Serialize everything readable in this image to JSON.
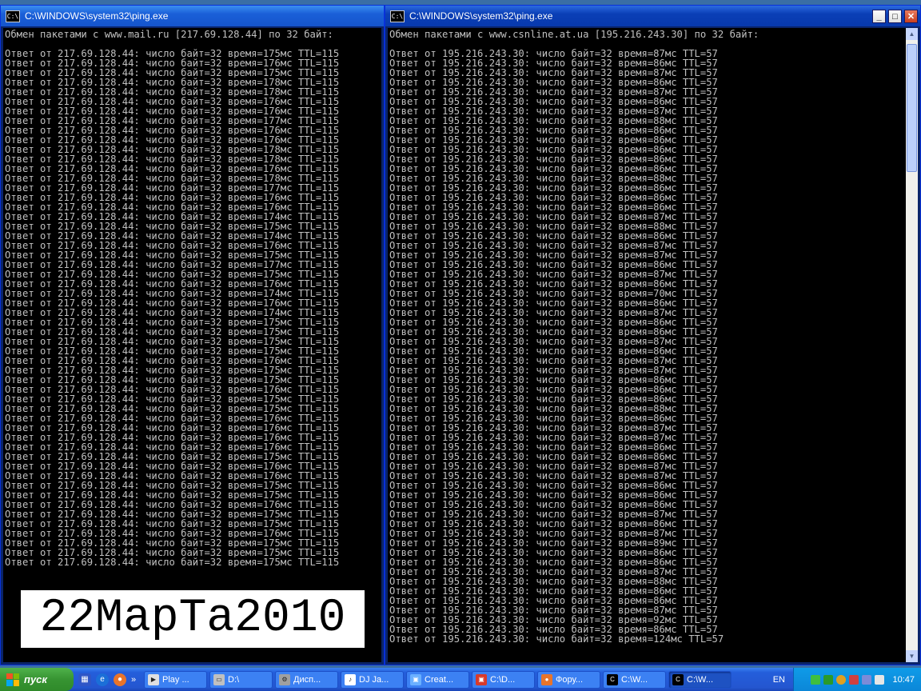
{
  "left_window": {
    "title": "C:\\WINDOWS\\system32\\ping.exe",
    "icon_text": "C:\\",
    "lines": [
      "Обмен пакетами с www.mail.ru [217.69.128.44] по 32 байт:",
      "",
      "Ответ от 217.69.128.44: число байт=32 время=175мс TTL=115",
      "Ответ от 217.69.128.44: число байт=32 время=176мс TTL=115",
      "Ответ от 217.69.128.44: число байт=32 время=175мс TTL=115",
      "Ответ от 217.69.128.44: число байт=32 время=178мс TTL=115",
      "Ответ от 217.69.128.44: число байт=32 время=178мс TTL=115",
      "Ответ от 217.69.128.44: число байт=32 время=176мс TTL=115",
      "Ответ от 217.69.128.44: число байт=32 время=176мс TTL=115",
      "Ответ от 217.69.128.44: число байт=32 время=177мс TTL=115",
      "Ответ от 217.69.128.44: число байт=32 время=176мс TTL=115",
      "Ответ от 217.69.128.44: число байт=32 время=176мс TTL=115",
      "Ответ от 217.69.128.44: число байт=32 время=178мс TTL=115",
      "Ответ от 217.69.128.44: число байт=32 время=178мс TTL=115",
      "Ответ от 217.69.128.44: число байт=32 время=176мс TTL=115",
      "Ответ от 217.69.128.44: число байт=32 время=178мс TTL=115",
      "Ответ от 217.69.128.44: число байт=32 время=177мс TTL=115",
      "Ответ от 217.69.128.44: число байт=32 время=176мс TTL=115",
      "Ответ от 217.69.128.44: число байт=32 время=176мс TTL=115",
      "Ответ от 217.69.128.44: число байт=32 время=174мс TTL=115",
      "Ответ от 217.69.128.44: число байт=32 время=175мс TTL=115",
      "Ответ от 217.69.128.44: число байт=32 время=174мс TTL=115",
      "Ответ от 217.69.128.44: число байт=32 время=176мс TTL=115",
      "Ответ от 217.69.128.44: число байт=32 время=175мс TTL=115",
      "Ответ от 217.69.128.44: число байт=32 время=177мс TTL=115",
      "Ответ от 217.69.128.44: число байт=32 время=175мс TTL=115",
      "Ответ от 217.69.128.44: число байт=32 время=176мс TTL=115",
      "Ответ от 217.69.128.44: число байт=32 время=174мс TTL=115",
      "Ответ от 217.69.128.44: число байт=32 время=176мс TTL=115",
      "Ответ от 217.69.128.44: число байт=32 время=174мс TTL=115",
      "Ответ от 217.69.128.44: число байт=32 время=175мс TTL=115",
      "Ответ от 217.69.128.44: число байт=32 время=175мс TTL=115",
      "Ответ от 217.69.128.44: число байт=32 время=175мс TTL=115",
      "Ответ от 217.69.128.44: число байт=32 время=175мс TTL=115",
      "Ответ от 217.69.128.44: число байт=32 время=176мс TTL=115",
      "Ответ от 217.69.128.44: число байт=32 время=175мс TTL=115",
      "Ответ от 217.69.128.44: число байт=32 время=175мс TTL=115",
      "Ответ от 217.69.128.44: число байт=32 время=176мс TTL=115",
      "Ответ от 217.69.128.44: число байт=32 время=175мс TTL=115",
      "Ответ от 217.69.128.44: число байт=32 время=175мс TTL=115",
      "Ответ от 217.69.128.44: число байт=32 время=176мс TTL=115",
      "Ответ от 217.69.128.44: число байт=32 время=176мс TTL=115",
      "Ответ от 217.69.128.44: число байт=32 время=176мс TTL=115",
      "Ответ от 217.69.128.44: число байт=32 время=176мс TTL=115",
      "Ответ от 217.69.128.44: число байт=32 время=175мс TTL=115",
      "Ответ от 217.69.128.44: число байт=32 время=176мс TTL=115",
      "Ответ от 217.69.128.44: число байт=32 время=176мс TTL=115",
      "Ответ от 217.69.128.44: число байт=32 время=175мс TTL=115",
      "Ответ от 217.69.128.44: число байт=32 время=175мс TTL=115",
      "Ответ от 217.69.128.44: число байт=32 время=176мс TTL=115",
      "Ответ от 217.69.128.44: число байт=32 время=175мс TTL=115",
      "Ответ от 217.69.128.44: число байт=32 время=175мс TTL=115",
      "Ответ от 217.69.128.44: число байт=32 время=176мс TTL=115",
      "Ответ от 217.69.128.44: число байт=32 время=175мс TTL=115",
      "Ответ от 217.69.128.44: число байт=32 время=175мс TTL=115",
      "Ответ от 217.69.128.44: число байт=32 время=175мс TTL=115"
    ]
  },
  "right_window": {
    "title": "C:\\WINDOWS\\system32\\ping.exe",
    "icon_text": "C:\\",
    "buttons": {
      "minimize": "_",
      "maximize": "□",
      "close": "✕"
    },
    "lines": [
      "Обмен пакетами с www.csnline.at.ua [195.216.243.30] по 32 байт:",
      "",
      "Ответ от 195.216.243.30: число байт=32 время=87мс TTL=57",
      "Ответ от 195.216.243.30: число байт=32 время=86мс TTL=57",
      "Ответ от 195.216.243.30: число байт=32 время=87мс TTL=57",
      "Ответ от 195.216.243.30: число байт=32 время=86мс TTL=57",
      "Ответ от 195.216.243.30: число байт=32 время=87мс TTL=57",
      "Ответ от 195.216.243.30: число байт=32 время=86мс TTL=57",
      "Ответ от 195.216.243.30: число байт=32 время=87мс TTL=57",
      "Ответ от 195.216.243.30: число байт=32 время=88мс TTL=57",
      "Ответ от 195.216.243.30: число байт=32 время=86мс TTL=57",
      "Ответ от 195.216.243.30: число байт=32 время=86мс TTL=57",
      "Ответ от 195.216.243.30: число байт=32 время=86мс TTL=57",
      "Ответ от 195.216.243.30: число байт=32 время=86мс TTL=57",
      "Ответ от 195.216.243.30: число байт=32 время=86мс TTL=57",
      "Ответ от 195.216.243.30: число байт=32 время=88мс TTL=57",
      "Ответ от 195.216.243.30: число байт=32 время=86мс TTL=57",
      "Ответ от 195.216.243.30: число байт=32 время=86мс TTL=57",
      "Ответ от 195.216.243.30: число байт=32 время=86мс TTL=57",
      "Ответ от 195.216.243.30: число байт=32 время=87мс TTL=57",
      "Ответ от 195.216.243.30: число байт=32 время=88мс TTL=57",
      "Ответ от 195.216.243.30: число байт=32 время=86мс TTL=57",
      "Ответ от 195.216.243.30: число байт=32 время=87мс TTL=57",
      "Ответ от 195.216.243.30: число байт=32 время=87мс TTL=57",
      "Ответ от 195.216.243.30: число байт=32 время=86мс TTL=57",
      "Ответ от 195.216.243.30: число байт=32 время=87мс TTL=57",
      "Ответ от 195.216.243.30: число байт=32 время=86мс TTL=57",
      "Ответ от 195.216.243.30: число байт=32 время=70мс TTL=57",
      "Ответ от 195.216.243.30: число байт=32 время=86мс TTL=57",
      "Ответ от 195.216.243.30: число байт=32 время=87мс TTL=57",
      "Ответ от 195.216.243.30: число байт=32 время=86мс TTL=57",
      "Ответ от 195.216.243.30: число байт=32 время=86мс TTL=57",
      "Ответ от 195.216.243.30: число байт=32 время=87мс TTL=57",
      "Ответ от 195.216.243.30: число байт=32 время=86мс TTL=57",
      "Ответ от 195.216.243.30: число байт=32 время=87мс TTL=57",
      "Ответ от 195.216.243.30: число байт=32 время=87мс TTL=57",
      "Ответ от 195.216.243.30: число байт=32 время=86мс TTL=57",
      "Ответ от 195.216.243.30: число байт=32 время=86мс TTL=57",
      "Ответ от 195.216.243.30: число байт=32 время=86мс TTL=57",
      "Ответ от 195.216.243.30: число байт=32 время=88мс TTL=57",
      "Ответ от 195.216.243.30: число байт=32 время=86мс TTL=57",
      "Ответ от 195.216.243.30: число байт=32 время=87мс TTL=57",
      "Ответ от 195.216.243.30: число байт=32 время=87мс TTL=57",
      "Ответ от 195.216.243.30: число байт=32 время=86мс TTL=57",
      "Ответ от 195.216.243.30: число байт=32 время=86мс TTL=57",
      "Ответ от 195.216.243.30: число байт=32 время=87мс TTL=57",
      "Ответ от 195.216.243.30: число байт=32 время=87мс TTL=57",
      "Ответ от 195.216.243.30: число байт=32 время=86мс TTL=57",
      "Ответ от 195.216.243.30: число байт=32 время=86мс TTL=57",
      "Ответ от 195.216.243.30: число байт=32 время=86мс TTL=57",
      "Ответ от 195.216.243.30: число байт=32 время=87мс TTL=57",
      "Ответ от 195.216.243.30: число байт=32 время=86мс TTL=57",
      "Ответ от 195.216.243.30: число байт=32 время=87мс TTL=57",
      "Ответ от 195.216.243.30: число байт=32 время=89мс TTL=57",
      "Ответ от 195.216.243.30: число байт=32 время=86мс TTL=57",
      "Ответ от 195.216.243.30: число байт=32 время=86мс TTL=57",
      "Ответ от 195.216.243.30: число байт=32 время=87мс TTL=57",
      "Ответ от 195.216.243.30: число байт=32 время=88мс TTL=57",
      "Ответ от 195.216.243.30: число байт=32 время=86мс TTL=57",
      "Ответ от 195.216.243.30: число байт=32 время=86мс TTL=57",
      "Ответ от 195.216.243.30: число байт=32 время=87мс TTL=57",
      "Ответ от 195.216.243.30: число байт=32 время=92мс TTL=57",
      "Ответ от 195.216.243.30: число байт=32 время=86мс TTL=57",
      "Ответ от 195.216.243.30: число байт=32 время=124мс TTL=57"
    ]
  },
  "watermark_text": "22МарТа2010",
  "taskbar": {
    "start_label": "пуск",
    "quick_launch": [
      "show-desktop-icon",
      "ie-icon",
      "firefox-icon"
    ],
    "chevron": "»",
    "tasks": [
      "Play ...",
      "D:\\",
      "Дисп...",
      "DJ Ja...",
      "Creat...",
      "C:\\D...",
      "Фору...",
      "C:\\W...",
      "C:\\W..."
    ],
    "lang": "EN",
    "clock": "10:47"
  }
}
